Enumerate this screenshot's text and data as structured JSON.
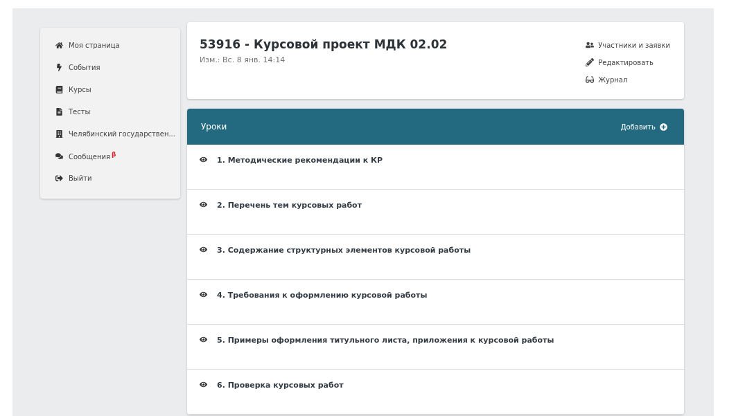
{
  "sidebar": {
    "items": [
      {
        "label": "Моя страница"
      },
      {
        "label": "События"
      },
      {
        "label": "Курсы"
      },
      {
        "label": "Тесты"
      },
      {
        "label": "Челябинский государствен..."
      },
      {
        "label": "Сообщения",
        "badge": "β"
      },
      {
        "label": "Выйти"
      }
    ]
  },
  "course": {
    "title": "53916 - Курсовой проект МДК 02.02",
    "modified": "Изм.: Вс. 8 янв. 14:14",
    "actions": [
      "Участники и заявки",
      "Редактировать",
      "Журнал"
    ]
  },
  "lessons": {
    "title": "Уроки",
    "add_button": "Добавить",
    "items": [
      {
        "title": "1. Методические рекомендации к КР"
      },
      {
        "title": "2. Перечень тем курсовых работ"
      },
      {
        "title": "3. Содержание структурных элементов курсовой работы"
      },
      {
        "title": "4. Требования к оформлению курсовой работы"
      },
      {
        "title": "5. Примеры оформления титульного листа, приложения к курсовой работы"
      },
      {
        "title": "6. Проверка курсовых работ"
      }
    ]
  }
}
